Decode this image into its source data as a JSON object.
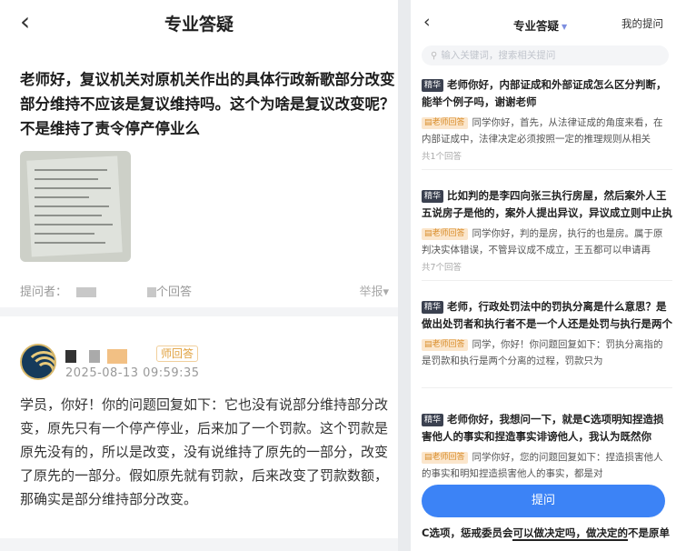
{
  "left": {
    "back_icon": "back-arrow",
    "title": "专业答疑",
    "question": "老师好，复议机关对原机关作出的具体行政新歌部分改变部分维持不应该是复议维持吗。这个为啥是复议改变呢？不是维持了责令停产停业么",
    "asker_label": "提问者：",
    "answer_count_suffix": "个回答",
    "report_label": "举报",
    "answerer_badge": "师回答",
    "answer_time": "2025-08-13 09:59:35",
    "answer_text": "学员，你好！你的问题回复如下：它也没有说部分维持部分改变，原先只有一个停产停业，后来加了一个罚款。这个罚款是原先没有的，所以是改变，没有说维持了原先的一部分，改变了原先的一部分。假如原先就有罚款，后来改变了罚款数额，那确实是部分维持部分改变。"
  },
  "right": {
    "back_icon": "back-arrow",
    "title": "专业答疑",
    "my_questions": "我的提问",
    "search_placeholder": "输入关键词，搜索相关提问",
    "featured_tag": "精华",
    "teacher_tag": "老师回答",
    "cards": [
      {
        "question": "老师你好，内部证成和外部证成怎么区分判断，能举个例子吗，谢谢老师",
        "answer": "同学你好，首先，从法律证成的角度来看，在内部证成中，法律决定必须按照一定的推理规则从相关",
        "count": "共1个回答"
      },
      {
        "question": "比如判的是李四向张三执行房屋，然后案外人王五说房子是他的，案外人提出异议，异议成立则中止执",
        "answer": "同学你好，判的是房，执行的也是房。属于原判决实体错误，不管异议成不成立，王五都可以申请再",
        "count": "共7个回答"
      },
      {
        "question": "老师，行政处罚法中的罚执分离是什么意思？是做出处罚者和执行者不是一个人还是处罚与执行是两个",
        "answer": "同学，你好！你问题回复如下：罚执分离指的是罚款和执行是两个分离的过程，罚款只为",
        "count": ""
      },
      {
        "question": "老师你好，我想问一下，就是C选项明知捏造损害他人的事实和捏造事实诽谤他人，我认为既然你",
        "answer": "同学你好，您的问题回复如下：捏造损害他人的事实和明知捏造损害他人的事实，都是对",
        "count": ""
      }
    ],
    "ask_button": "提问",
    "tail_text_a": "C选项，惩戒委员会",
    "tail_text_b": "可以做决定吗，做决定的",
    "tail_text_c": "不是原单"
  }
}
